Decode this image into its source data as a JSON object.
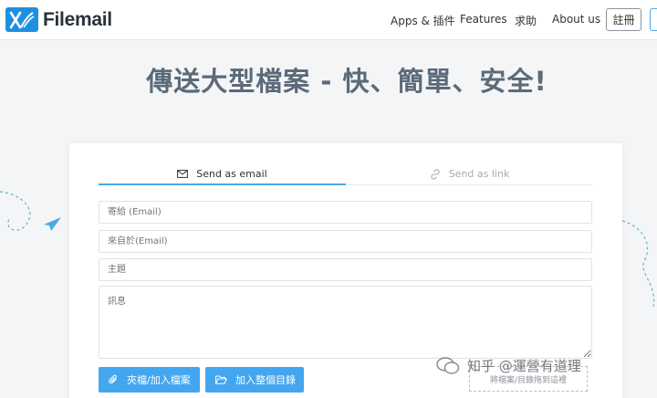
{
  "header": {
    "logo_text": "Filemail",
    "nav": [
      "Apps & 插件",
      "Features",
      "求助",
      "About us"
    ],
    "register_label": "註冊"
  },
  "hero": {
    "title": "傳送大型檔案 - 快、簡單、安全!"
  },
  "tabs": [
    {
      "label": "Send as email",
      "icon": "envelope-icon",
      "active": true
    },
    {
      "label": "Send as link",
      "icon": "link-icon",
      "active": false
    }
  ],
  "form": {
    "to_placeholder": "寄給 (Email)",
    "from_placeholder": "來自於(Email)",
    "subject_placeholder": "主題",
    "message_placeholder": "訊息"
  },
  "buttons": {
    "add_files": "夾檔/加入檔案",
    "add_folder": "加入整個目錄"
  },
  "dropzone_text": "將檔案/目錄拖到這裡",
  "watermark": "知乎 @運營有道理",
  "colors": {
    "accent": "#44a6ee",
    "logo": "#1f8fe0",
    "headline": "#5c6a79"
  }
}
